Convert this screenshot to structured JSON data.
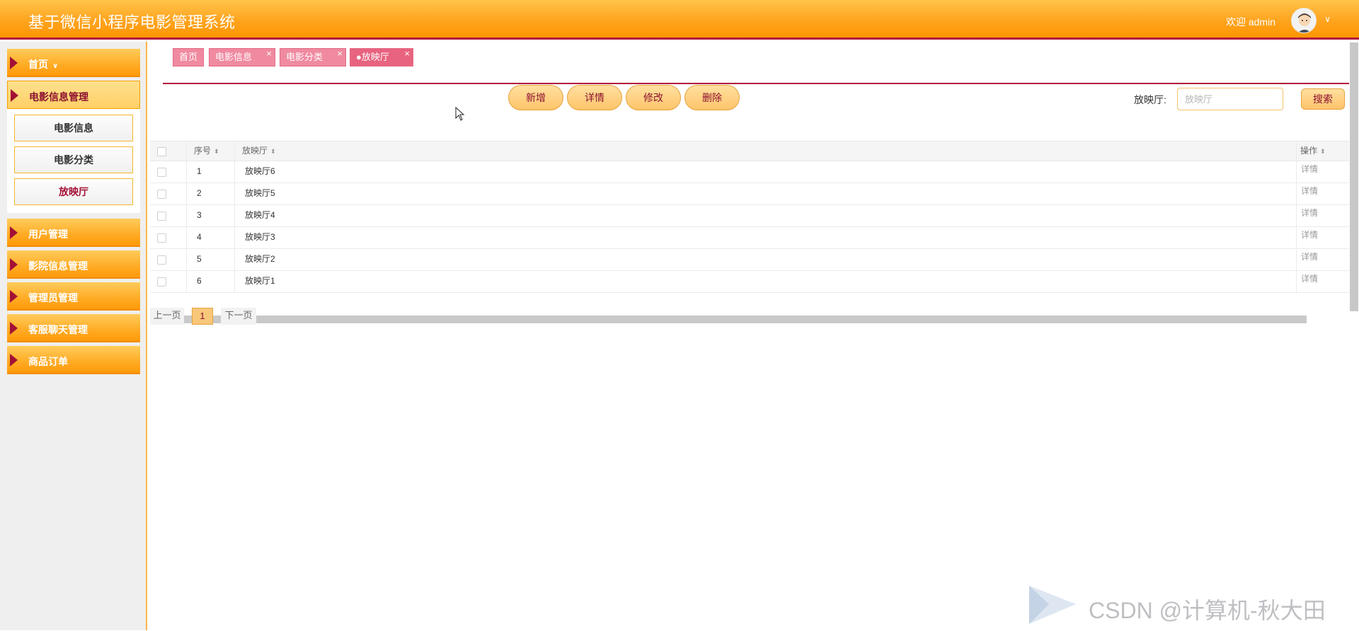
{
  "header": {
    "title": "基于微信小程序电影管理系统",
    "welcome": "欢迎 admin",
    "user_caret": "∨"
  },
  "sidebar": {
    "items": [
      {
        "label": "首页",
        "chevron": "∨"
      },
      {
        "label": "电影信息管理"
      },
      {
        "label": "用户管理"
      },
      {
        "label": "影院信息管理"
      },
      {
        "label": "管理员管理"
      },
      {
        "label": "客服聊天管理"
      },
      {
        "label": "商品订单"
      }
    ],
    "submenu": [
      {
        "label": "电影信息"
      },
      {
        "label": "电影分类"
      },
      {
        "label": "放映厅"
      }
    ]
  },
  "tabs": [
    {
      "label": "首页"
    },
    {
      "label": "电影信息",
      "close": "×"
    },
    {
      "label": "电影分类",
      "close": "×"
    },
    {
      "label": "●放映厅",
      "close": "×"
    }
  ],
  "toolbar": {
    "add": "新增",
    "detail": "详情",
    "edit": "修改",
    "delete": "删除"
  },
  "search": {
    "label": "放映厅:",
    "placeholder": "放映厅",
    "button": "搜索"
  },
  "table": {
    "columns": {
      "index": "序号",
      "name": "放映厅",
      "action": "操作"
    },
    "sort_icon": "⬍",
    "rows": [
      {
        "index": "1",
        "name": "放映厅6",
        "action": "详情"
      },
      {
        "index": "2",
        "name": "放映厅5",
        "action": "详情"
      },
      {
        "index": "3",
        "name": "放映厅4",
        "action": "详情"
      },
      {
        "index": "4",
        "name": "放映厅3",
        "action": "详情"
      },
      {
        "index": "5",
        "name": "放映厅2",
        "action": "详情"
      },
      {
        "index": "6",
        "name": "放映厅1",
        "action": "详情"
      }
    ]
  },
  "pager": {
    "prev": "上一页",
    "current": "1",
    "next": "下一页"
  },
  "watermark": "CSDN @计算机-秋大田",
  "colors": {
    "header_orange": "#ffa41f",
    "accent_crimson": "#b0153c",
    "tab_pink": "#f08aa0",
    "button_text": "#8b1030"
  }
}
